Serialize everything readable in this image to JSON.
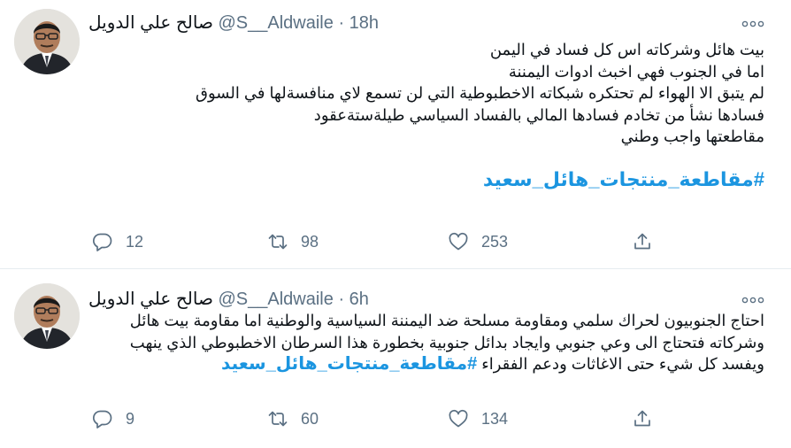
{
  "tweets": [
    {
      "author": {
        "name": "صالح علي الدويل",
        "handle": "@S__Aldwaile",
        "time": "18h"
      },
      "body_lines": [
        "بيت هائل وشركاته اس كل فساد في اليمن",
        "اما في الجنوب فهي اخبث ادوات اليمننة",
        "لم يتبق الا الهواء لم تحتكره شبكاته الاخطبوطية التي لن تسمع لاي منافسةلها في السوق",
        "فسادها نشأ من تخادم فسادها المالي بالفساد السياسي طيلةستةعقود",
        "مقاطعتها واجب وطني"
      ],
      "hashtag": "#مقاطعة_منتجات_هائل_سعيد",
      "stats": {
        "replies": "12",
        "retweets": "98",
        "likes": "253"
      }
    },
    {
      "author": {
        "name": "صالح علي الدويل",
        "handle": "@S__Aldwaile",
        "time": "6h"
      },
      "body_lines": [
        "احتاج الجنوبيون لحراك سلمي ومقاومة مسلحة ضد اليمننة السياسية والوطنية  اما مقاومة بيت هائل",
        "وشركاته فتحتاج الى وعي جنوبي وايجاد بدائل جنوبية بخطورة هذا السرطان الاخطبوطي الذي ينهب",
        "ويفسد كل شيء حتى الاغاثات ودعم الفقراء"
      ],
      "hashtag": "#مقاطعة_منتجات_هائل_سعيد",
      "stats": {
        "replies": "9",
        "retweets": "60",
        "likes": "134"
      }
    }
  ],
  "ui": {
    "dot": "·",
    "more_icon": "more-horizontal-icon",
    "reply_icon": "reply-bubble-icon",
    "retweet_icon": "retweet-icon",
    "like_icon": "heart-icon",
    "share_icon": "share-upload-icon"
  },
  "colors": {
    "text": "#0f1419",
    "secondary": "#5b7083",
    "hashtag": "#1b95e0",
    "divider": "#e6ecf0"
  }
}
